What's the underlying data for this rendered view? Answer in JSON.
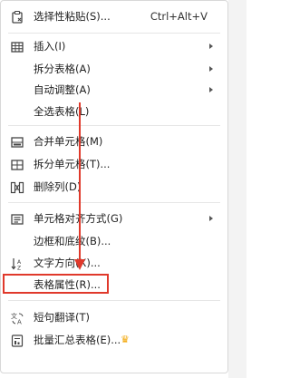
{
  "menu": {
    "items": [
      {
        "label": "选择性粘贴(S)...",
        "shortcut": "Ctrl+Alt+V",
        "icon": "paste-special-icon"
      },
      {
        "label": "插入(I)",
        "icon": "table-insert-icon",
        "submenu": true
      },
      {
        "label": "拆分表格(A)",
        "submenu": true
      },
      {
        "label": "自动调整(A)",
        "submenu": true
      },
      {
        "label": "全选表格(L)"
      },
      {
        "label": "合并单元格(M)",
        "icon": "merge-cells-icon"
      },
      {
        "label": "拆分单元格(T)...",
        "icon": "split-cells-icon"
      },
      {
        "label": "删除列(D)",
        "icon": "delete-column-icon"
      },
      {
        "label": "单元格对齐方式(G)",
        "icon": "cell-align-icon",
        "submenu": true
      },
      {
        "label": "边框和底纹(B)..."
      },
      {
        "label": "文字方向(X)...",
        "icon": "text-direction-icon"
      },
      {
        "label": "表格属性(R)..."
      },
      {
        "label": "短句翻译(T)",
        "icon": "translate-icon"
      },
      {
        "label": "批量汇总表格(E)...",
        "icon": "batch-summary-icon",
        "badge": "crown-icon"
      }
    ]
  },
  "colors": {
    "highlight_border": "#e0392b",
    "annotation_arrow": "#e0392b",
    "icon_color": "#444444",
    "crown": "#f2a400"
  }
}
